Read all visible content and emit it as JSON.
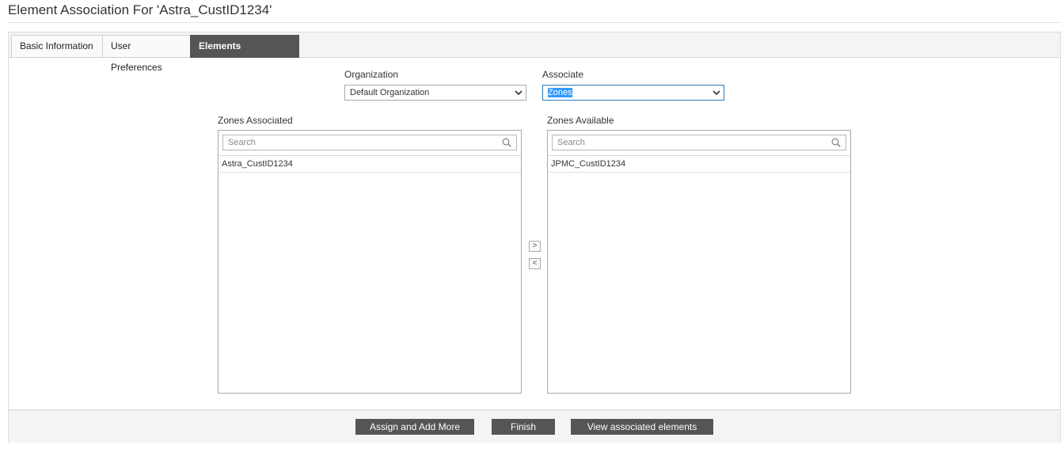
{
  "page": {
    "title": "Element Association For 'Astra_CustID1234'"
  },
  "tabs": [
    {
      "label": "Basic Information",
      "active": false
    },
    {
      "label": "User Preferences",
      "active": false
    },
    {
      "label": "Elements Association",
      "active": true
    }
  ],
  "form": {
    "organization": {
      "label": "Organization",
      "value": "Default Organization"
    },
    "associate": {
      "label": "Associate",
      "value": "Zones"
    }
  },
  "associated": {
    "title": "Zones Associated",
    "search_placeholder": "Search",
    "items": [
      "Astra_CustID1234"
    ]
  },
  "available": {
    "title": "Zones Available",
    "search_placeholder": "Search",
    "items": [
      "JPMC_CustID1234"
    ]
  },
  "transfer": {
    "move_right": ">",
    "move_left": "<"
  },
  "footer": {
    "assign_label": "Assign and Add More",
    "finish_label": "Finish",
    "view_label": "View associated elements"
  },
  "colors": {
    "accent": "#555555",
    "focus": "#2a7ab8",
    "selection": "#3399ff"
  },
  "icons": {
    "search": "magnifier-icon",
    "dropdown": "chevron-down-icon"
  }
}
